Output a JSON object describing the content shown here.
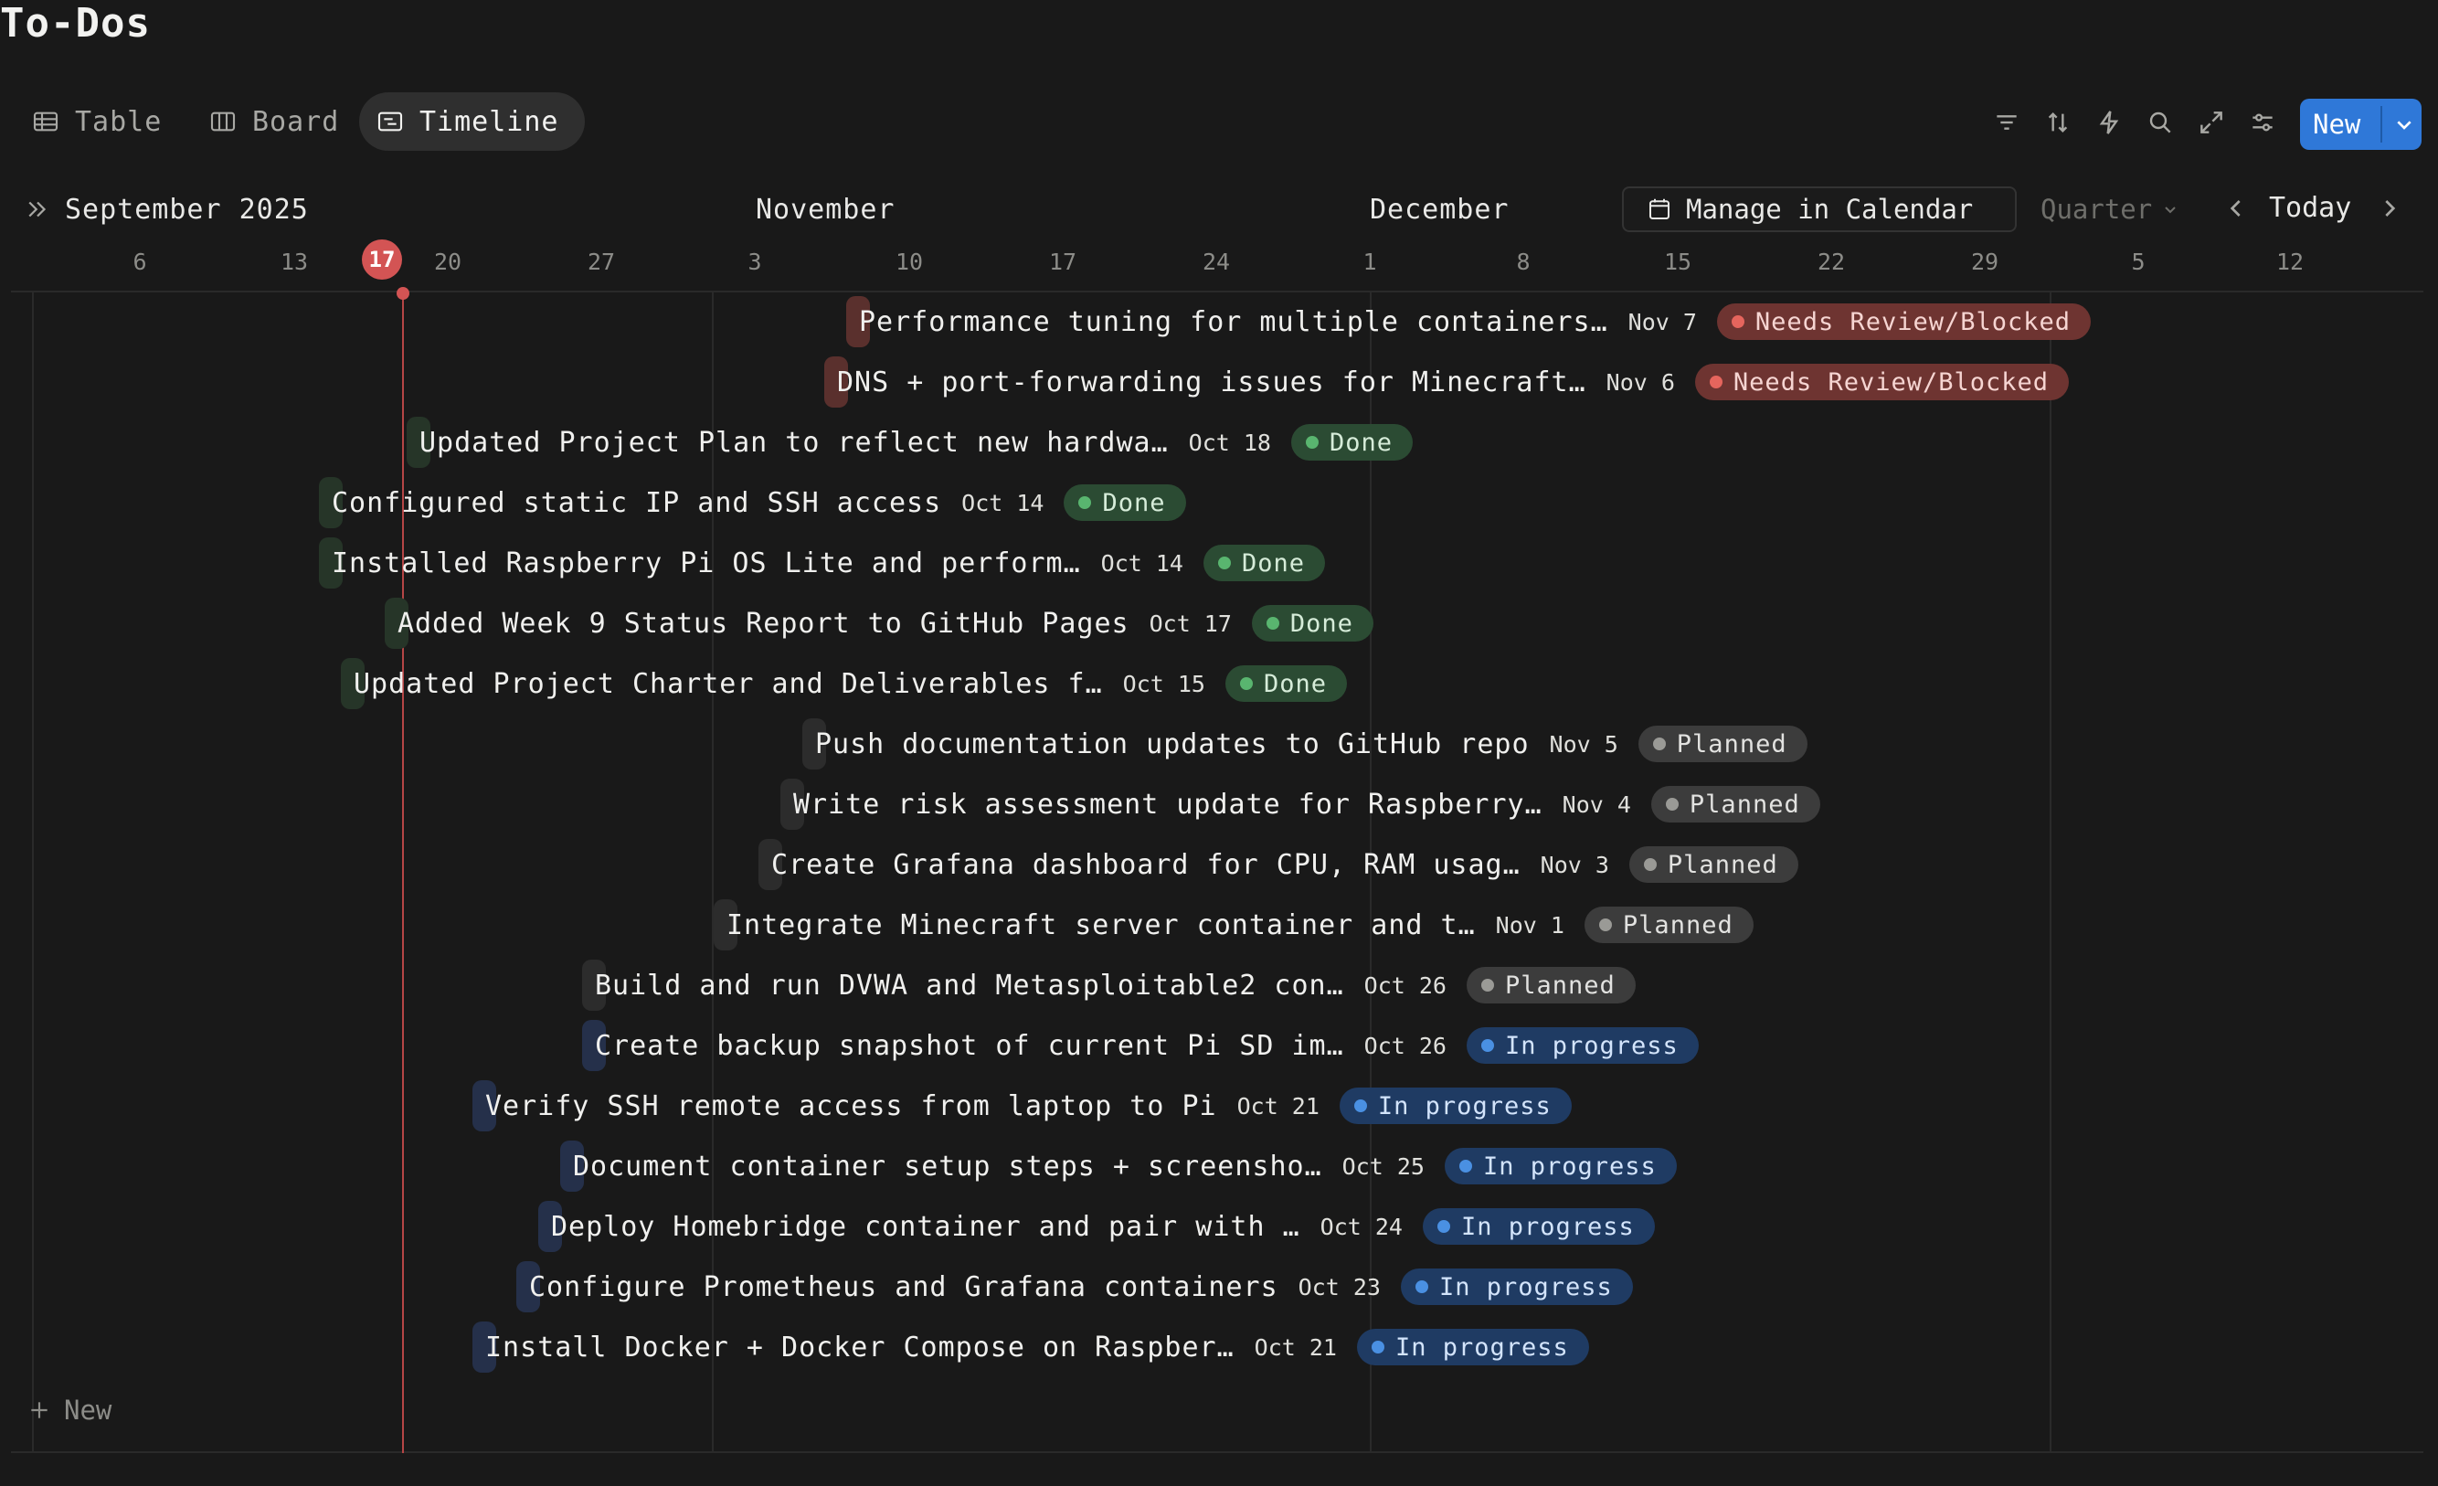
{
  "page": {
    "title": "To-Dos"
  },
  "views": [
    {
      "label": "Table",
      "icon": "table-icon"
    },
    {
      "label": "Board",
      "icon": "board-icon"
    },
    {
      "label": "Timeline",
      "icon": "timeline-icon",
      "active": true
    }
  ],
  "toolbar": {
    "icons": [
      "filter-icon",
      "sort-icon",
      "automation-icon",
      "search-icon",
      "expand-icon",
      "settings-icon"
    ],
    "new_label": "New"
  },
  "timeline": {
    "months": {
      "current": "September 2025",
      "nov": "November",
      "dec": "December"
    },
    "days": [
      "6",
      "13",
      "17",
      "20",
      "27",
      "3",
      "10",
      "17",
      "24",
      "1",
      "8",
      "15",
      "22",
      "29",
      "5",
      "12"
    ],
    "today_day": "17",
    "manage_calendar_label": "Manage in Calendar",
    "range_label": "Quarter",
    "today_label": "Today"
  },
  "tasks": [
    {
      "title": "Performance tuning for multiple containers…",
      "date": "Nov 7",
      "status": "Needs Review/Blocked"
    },
    {
      "title": "DNS + port-forwarding issues for Minecraft…",
      "date": "Nov 6",
      "status": "Needs Review/Blocked"
    },
    {
      "title": "Updated Project Plan to reflect new hardwa…",
      "date": "Oct 18",
      "status": "Done"
    },
    {
      "title": "Configured static IP and SSH access",
      "date": "Oct 14",
      "status": "Done"
    },
    {
      "title": "Installed Raspberry Pi OS Lite and perform…",
      "date": "Oct 14",
      "status": "Done"
    },
    {
      "title": "Added Week 9 Status Report to GitHub Pages",
      "date": "Oct 17",
      "status": "Done"
    },
    {
      "title": "Updated Project Charter and Deliverables f…",
      "date": "Oct 15",
      "status": "Done"
    },
    {
      "title": "Push documentation updates to GitHub repo",
      "date": "Nov 5",
      "status": "Planned"
    },
    {
      "title": "Write risk assessment update for Raspberry…",
      "date": "Nov 4",
      "status": "Planned"
    },
    {
      "title": "Create Grafana dashboard for CPU, RAM usag…",
      "date": "Nov 3",
      "status": "Planned"
    },
    {
      "title": "Integrate Minecraft server container and t…",
      "date": "Nov 1",
      "status": "Planned"
    },
    {
      "title": "Build and run DVWA and Metasploitable2 con…",
      "date": "Oct 26",
      "status": "Planned"
    },
    {
      "title": "Create backup snapshot of current Pi SD im…",
      "date": "Oct 26",
      "status": "In progress"
    },
    {
      "title": "Verify SSH remote access from laptop to Pi",
      "date": "Oct 21",
      "status": "In progress"
    },
    {
      "title": "Document container setup steps + screensho…",
      "date": "Oct 25",
      "status": "In progress"
    },
    {
      "title": "Deploy Homebridge container and pair with …",
      "date": "Oct 24",
      "status": "In progress"
    },
    {
      "title": "Configure Prometheus and Grafana containers",
      "date": "Oct 23",
      "status": "In progress"
    },
    {
      "title": "Install Docker + Docker Compose on Raspber…",
      "date": "Oct 21",
      "status": "In progress"
    }
  ],
  "add_new_label": "New",
  "colors": {
    "accent": "#2f78d8",
    "today": "#d35454",
    "background": "#191919"
  }
}
